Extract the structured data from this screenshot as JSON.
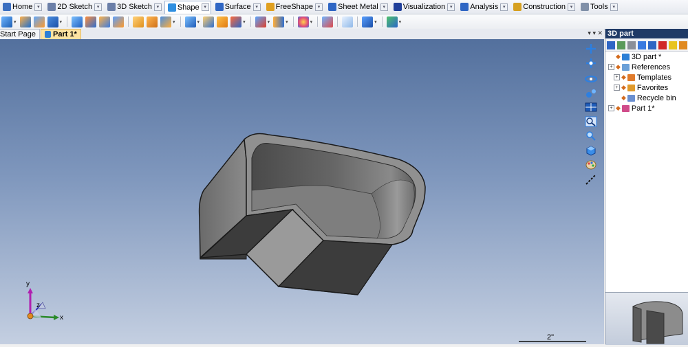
{
  "menu": {
    "tabs": [
      {
        "label": "Home",
        "icon": "home-icon",
        "color": "#3b6fc0"
      },
      {
        "label": "2D Sketch",
        "icon": "sketch-2d-icon",
        "color": "#6b7fa8"
      },
      {
        "label": "3D Sketch",
        "icon": "sketch-3d-icon",
        "color": "#6b7fa8"
      },
      {
        "label": "Shape",
        "icon": "shape-icon",
        "color": "#2f8fe0",
        "active": true
      },
      {
        "label": "Surface",
        "icon": "surface-icon",
        "color": "#2f66c4"
      },
      {
        "label": "FreeShape",
        "icon": "freeshape-icon",
        "color": "#e0a020"
      },
      {
        "label": "Sheet Metal",
        "icon": "sheet-metal-icon",
        "color": "#2f66c4"
      },
      {
        "label": "Visualization",
        "icon": "visualization-icon",
        "color": "#203f9a"
      },
      {
        "label": "Analysis",
        "icon": "analysis-icon",
        "color": "#2f66c4"
      },
      {
        "label": "Construction",
        "icon": "construction-icon",
        "color": "#d6a020"
      },
      {
        "label": "Tools",
        "icon": "tools-icon",
        "color": "#8090a8"
      }
    ]
  },
  "document_tabs": {
    "tabs": [
      {
        "label": "Start Page"
      },
      {
        "label": "Part 1*",
        "active": true
      }
    ],
    "controls": "▾ ▾ ✕"
  },
  "panel": {
    "title": "3D part",
    "tree": [
      {
        "label": "3D part *",
        "level": 0,
        "expander": "",
        "icon_color": "#2c7fd6"
      },
      {
        "label": "References",
        "level": 0,
        "expander": "+",
        "icon_color": "#6aa0d8"
      },
      {
        "label": "Templates",
        "level": 1,
        "expander": "+",
        "icon_color": "#e07b2c"
      },
      {
        "label": "Favorites",
        "level": 1,
        "expander": "+",
        "icon_color": "#e09a2c"
      },
      {
        "label": "Recycle bin",
        "level": 1,
        "expander": "",
        "icon_color": "#6a8fd0"
      },
      {
        "label": "Part 1*",
        "level": 0,
        "expander": "+",
        "icon_color": "#d04c8a"
      }
    ]
  },
  "viewport": {
    "axes": {
      "x": "x",
      "y": "y",
      "z": "z"
    },
    "scale_label": "2\"",
    "colors": {
      "axis_x": "#1f7a1f",
      "axis_y": "#a020a0",
      "axis_z": "#1f1fb0"
    }
  }
}
